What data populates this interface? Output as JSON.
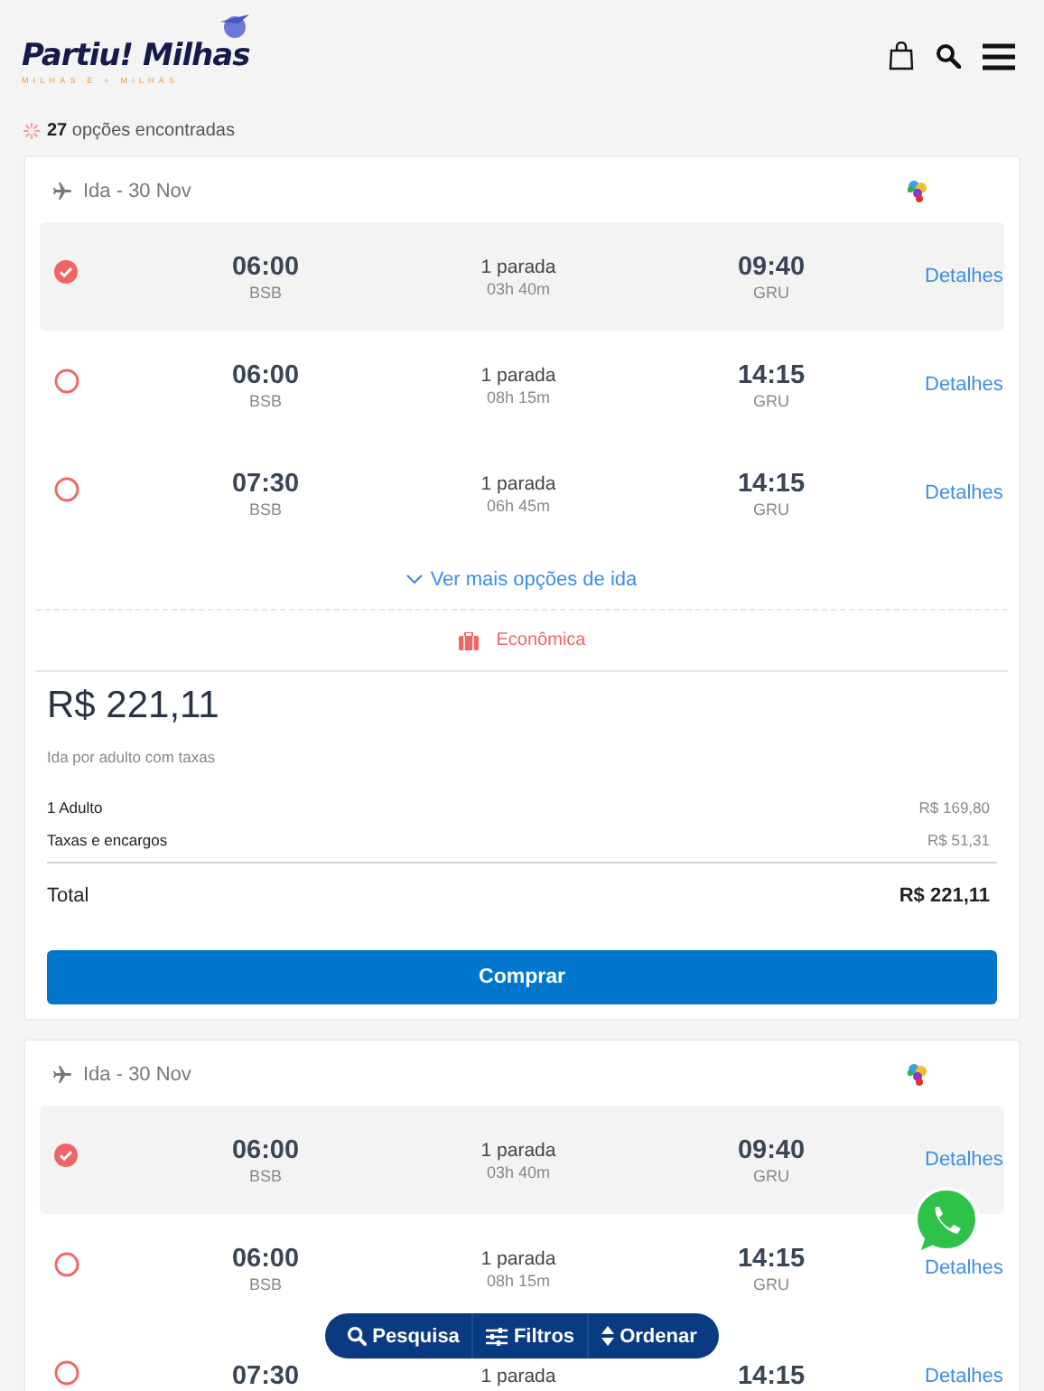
{
  "header": {
    "logo": "Partiu! Milhas",
    "tagline": "MILHAS E + MILHAS"
  },
  "summary": {
    "count": "27",
    "label": "opções encontradas"
  },
  "results": [
    {
      "trip": "Ida - 30 Nov",
      "flights": [
        {
          "selected": true,
          "dep": "06:00",
          "from": "BSB",
          "stops": "1 parada",
          "duration": "03h 40m",
          "arr": "09:40",
          "to": "GRU",
          "details": "Detalhes"
        },
        {
          "selected": false,
          "dep": "06:00",
          "from": "BSB",
          "stops": "1 parada",
          "duration": "08h 15m",
          "arr": "14:15",
          "to": "GRU",
          "details": "Detalhes"
        },
        {
          "selected": false,
          "dep": "07:30",
          "from": "BSB",
          "stops": "1 parada",
          "duration": "06h 45m",
          "arr": "14:15",
          "to": "GRU",
          "details": "Detalhes"
        }
      ],
      "more": "Ver mais opções de ida",
      "cabin": "Econômica",
      "price": "R$ 221,11",
      "price_note": "Ida por adulto com taxas",
      "lines": [
        {
          "label": "1 Adulto",
          "value": "R$ 169,80"
        },
        {
          "label": "Taxas e encargos",
          "value": "R$ 51,31"
        }
      ],
      "total_label": "Total",
      "total": "R$ 221,11",
      "buy": "Comprar"
    },
    {
      "trip": "Ida - 30 Nov",
      "flights": [
        {
          "selected": true,
          "dep": "06:00",
          "from": "BSB",
          "stops": "1 parada",
          "duration": "03h 40m",
          "arr": "09:40",
          "to": "GRU",
          "details": "Detalhes"
        },
        {
          "selected": false,
          "dep": "06:00",
          "from": "BSB",
          "stops": "1 parada",
          "duration": "08h 15m",
          "arr": "14:15",
          "to": "GRU",
          "details": "Detalhes"
        },
        {
          "selected": false,
          "dep": "07:30",
          "stops": "1 parada",
          "arr": "14:15",
          "details": "Detalhes"
        }
      ]
    }
  ],
  "bottom_bar": [
    {
      "kind": "search",
      "label": "Pesquisa"
    },
    {
      "kind": "filter",
      "label": "Filtros"
    },
    {
      "kind": "sort",
      "label": "Ordenar"
    }
  ]
}
